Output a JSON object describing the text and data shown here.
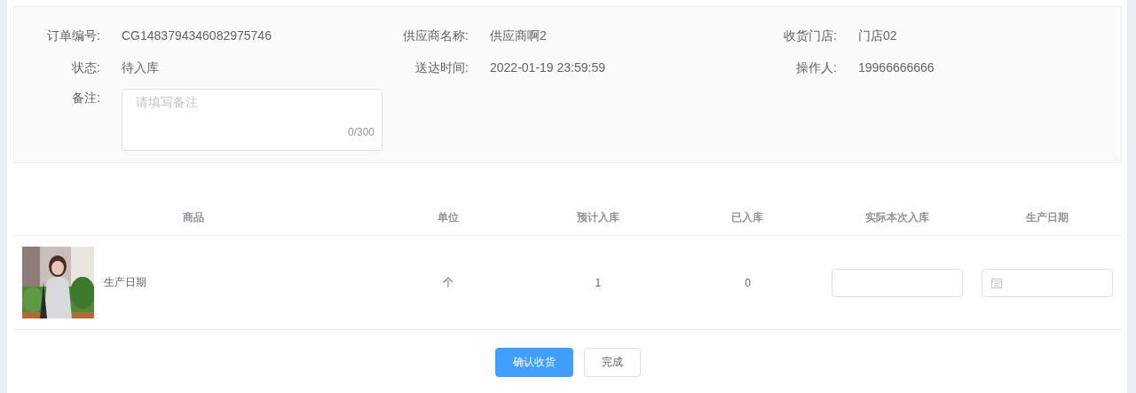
{
  "order_info": {
    "fields": [
      {
        "label": "订单编号:",
        "value": "CG1483794346082975746"
      },
      {
        "label": "供应商名称:",
        "value": "供应商啊2"
      },
      {
        "label": "收货门店:",
        "value": "门店02"
      },
      {
        "label": "状态:",
        "value": "待入库"
      },
      {
        "label": "送达时间:",
        "value": "2022-01-19 23:59:59"
      },
      {
        "label": "操作人:",
        "value": "19966666666"
      }
    ],
    "remark": {
      "label": "备注:",
      "placeholder": "请填写备注",
      "counter": "0/300"
    }
  },
  "table": {
    "columns": [
      "商品",
      "单位",
      "预计入库",
      "已入库",
      "实际本次入库",
      "生产日期"
    ],
    "rows": [
      {
        "product": "生产日期",
        "unit": "个",
        "expected": "1",
        "received": "0"
      }
    ]
  },
  "buttons": [
    {
      "label": "确认收货",
      "kind": "primary"
    },
    {
      "label": "完成",
      "kind": "default"
    }
  ]
}
